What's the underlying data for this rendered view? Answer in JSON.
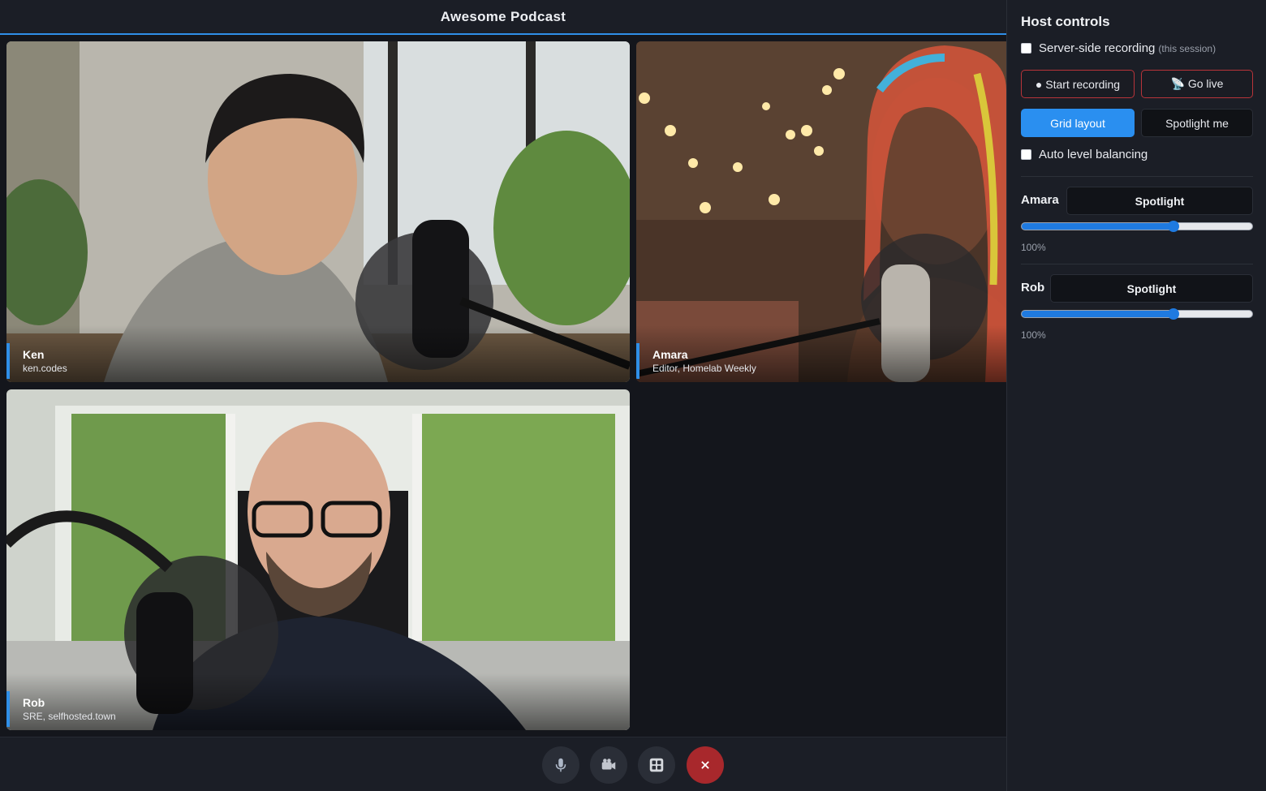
{
  "header": {
    "title": "Awesome Podcast"
  },
  "participants": [
    {
      "name": "Ken",
      "subtitle": "ken.codes"
    },
    {
      "name": "Amara",
      "subtitle": "Editor, Homelab Weekly"
    },
    {
      "name": "Rob",
      "subtitle": "SRE, selfhosted.town"
    }
  ],
  "controls": {
    "mic_icon": "microphone-icon",
    "camera_icon": "video-camera-icon",
    "layout_icon": "grid-layout-icon",
    "end_icon": "close-icon"
  },
  "sidebar": {
    "title": "Host controls",
    "recording_label": "Server-side recording",
    "recording_note": "(this session)",
    "recording_checked": false,
    "start_recording": "● Start recording",
    "go_live": "📡 Go live",
    "grid_layout": "Grid layout",
    "spotlight_me": "Spotlight me",
    "auto_level_label": "Auto level balancing",
    "auto_level_checked": false,
    "people": [
      {
        "name": "Amara",
        "spotlight_label": "Spotlight",
        "volume": 0.66,
        "volume_label": "100%"
      },
      {
        "name": "Rob",
        "spotlight_label": "Spotlight",
        "volume": 0.66,
        "volume_label": "100%"
      }
    ]
  },
  "colors": {
    "accent": "#2f8fe8",
    "danger": "#b8343a",
    "end_call": "#a8282c"
  }
}
